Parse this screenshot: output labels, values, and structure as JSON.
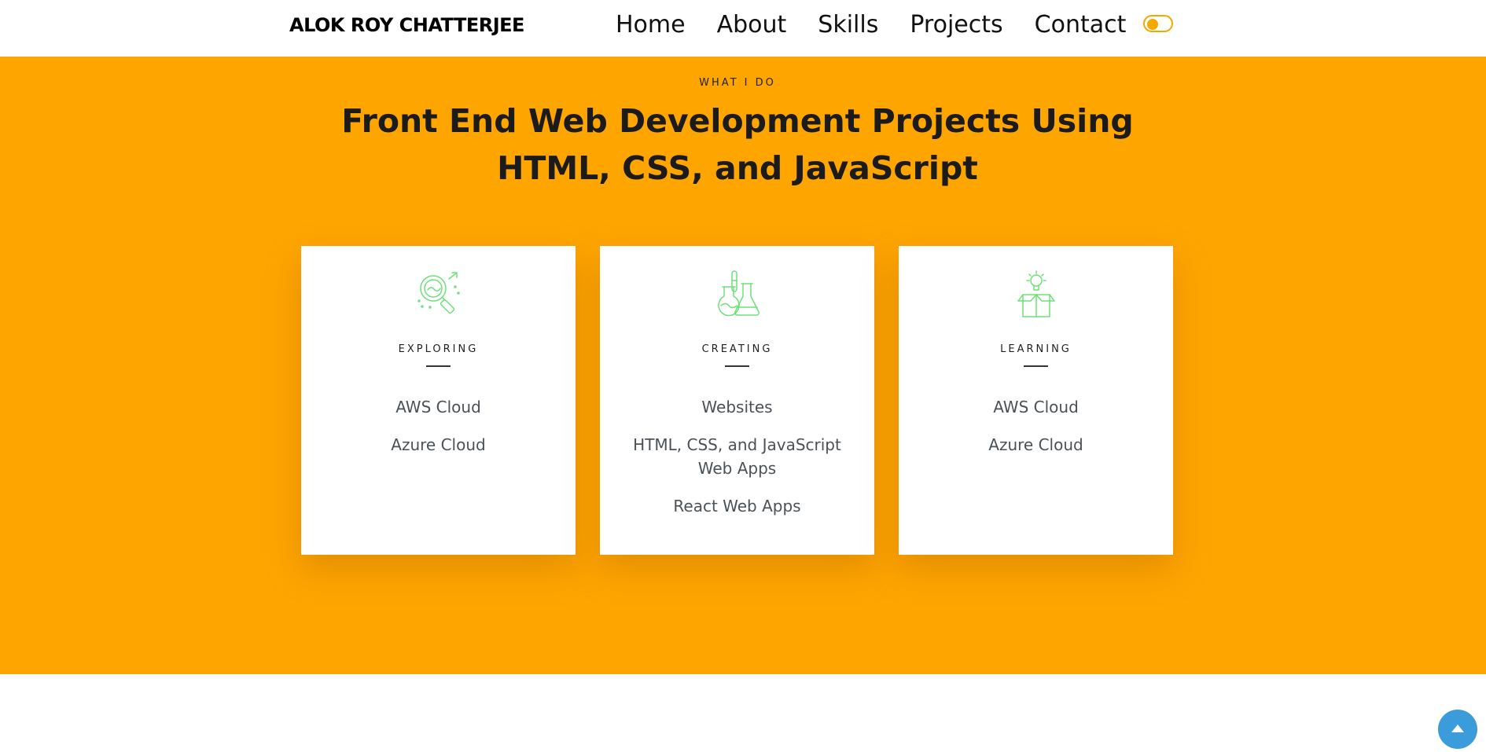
{
  "header": {
    "brand": "ALOK ROY CHATTERJEE",
    "nav": [
      {
        "label": "Home"
      },
      {
        "label": "About"
      },
      {
        "label": "Skills"
      },
      {
        "label": "Projects"
      },
      {
        "label": "Contact"
      }
    ],
    "theme_toggle": {
      "icon": "toggle-switch-icon",
      "state": "off"
    }
  },
  "section": {
    "eyebrow": "WHAT I DO",
    "headline": "Front End Web Development Projects Using HTML, CSS, and JavaScript",
    "cards": [
      {
        "icon": "magnifier-search-icon",
        "title": "EXPLORING",
        "items": [
          "AWS Cloud",
          "Azure Cloud"
        ]
      },
      {
        "icon": "lab-flasks-icon",
        "title": "CREATING",
        "items": [
          "Websites",
          "HTML, CSS, and JavaScript Web Apps",
          "React Web Apps"
        ]
      },
      {
        "icon": "lightbulb-box-icon",
        "title": "LEARNING",
        "items": [
          "AWS Cloud",
          "Azure Cloud"
        ]
      }
    ]
  },
  "scroll_top": {
    "icon": "arrow-up-icon"
  },
  "colors": {
    "accent_orange": "#ffa500",
    "icon_green": "#6ee07a",
    "scroll_button_blue": "#3b9cdc",
    "toggle_yellow": "#f5a800"
  }
}
